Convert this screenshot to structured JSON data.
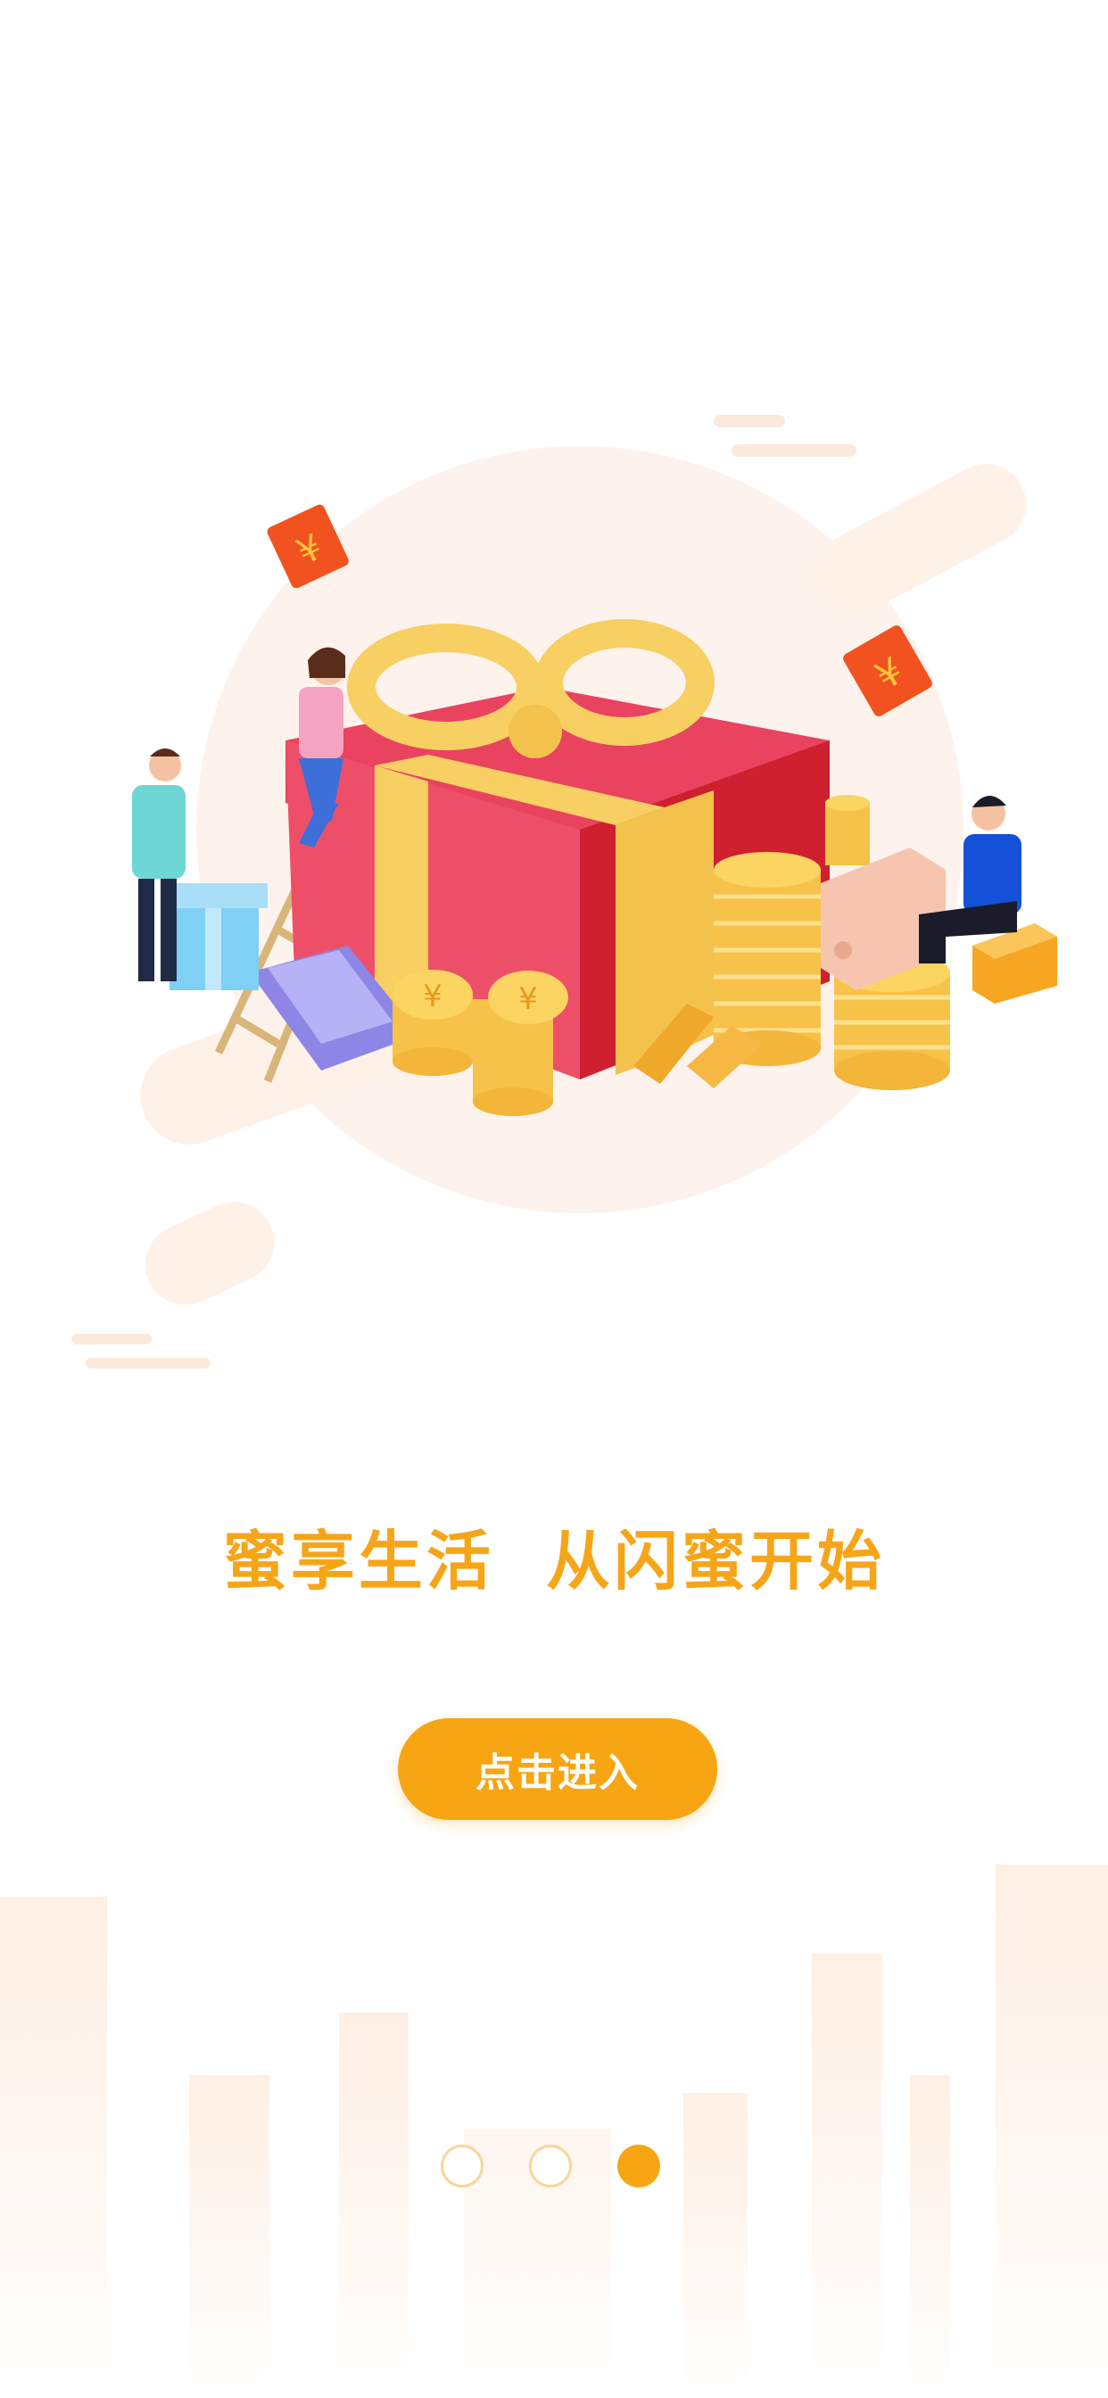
{
  "slogan": "蜜享生活  从闪蜜开始",
  "enter_button": {
    "label": "点击进入"
  },
  "pagination": {
    "total": 3,
    "active_index": 3
  },
  "colors": {
    "accent": "#f7a512",
    "slogan": "#f6a519",
    "skyline": "#fdeadb"
  },
  "illustration": {
    "coin_symbol": "¥"
  }
}
